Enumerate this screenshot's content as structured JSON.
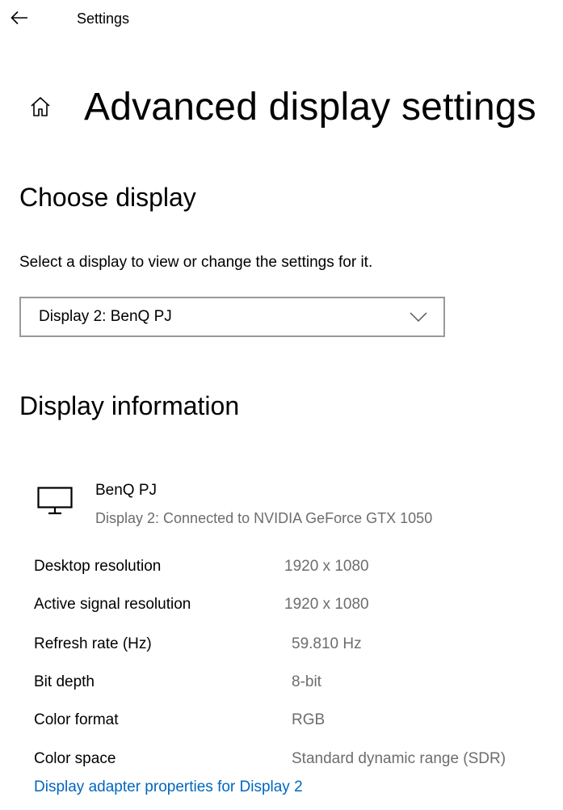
{
  "app": {
    "title": "Settings",
    "back_icon": "back-arrow-icon"
  },
  "page": {
    "home_icon": "home-icon",
    "title": "Advanced display settings"
  },
  "choose_display": {
    "heading": "Choose display",
    "description": "Select a display to view or change the settings for it.",
    "dropdown_value": "Display 2: BenQ PJ"
  },
  "display_information": {
    "heading": "Display information",
    "monitor": {
      "icon": "monitor-icon",
      "name": "BenQ PJ",
      "connection": "Display 2: Connected to NVIDIA GeForce GTX 1050"
    },
    "rows": [
      {
        "label": "Desktop resolution",
        "value": "1920 x 1080"
      },
      {
        "label": "Active signal resolution",
        "value": "1920 x 1080"
      },
      {
        "label": "Refresh rate (Hz)",
        "value": "59.810 Hz"
      },
      {
        "label": "Bit depth",
        "value": "8-bit"
      },
      {
        "label": "Color format",
        "value": "RGB"
      },
      {
        "label": "Color space",
        "value": "Standard dynamic range (SDR)"
      }
    ],
    "adapter_link": "Display adapter properties for Display 2"
  },
  "colors": {
    "link": "#0067c0",
    "secondary_text": "#6d6d6d",
    "dropdown_border": "#999999"
  }
}
